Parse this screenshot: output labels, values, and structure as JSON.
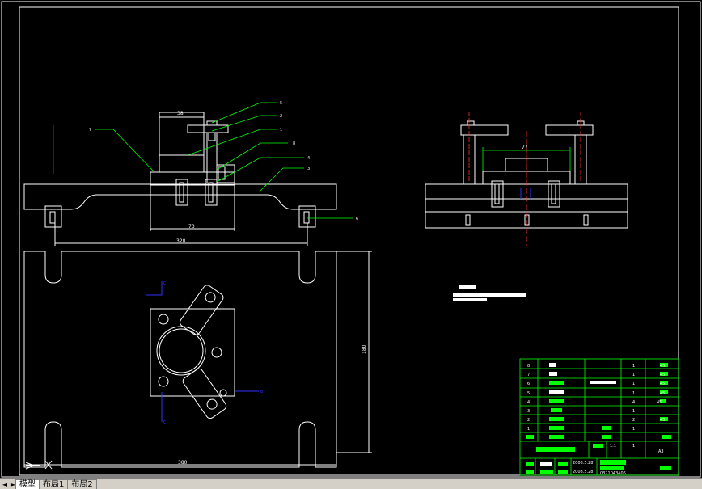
{
  "tabs": [
    {
      "label": "模型",
      "active": true
    },
    {
      "label": "布局1",
      "active": false
    },
    {
      "label": "布局2",
      "active": false
    }
  ],
  "tab_nav": {
    "first": "◄",
    "prev": "►"
  },
  "front_view": {
    "dim_top": "38",
    "dim_mid": "73",
    "dim_bottom": "320",
    "leaders": [
      "5",
      "2",
      "1",
      "8",
      "4",
      "3",
      "6",
      "7"
    ]
  },
  "side_view": {
    "dim_top": "77"
  },
  "plan_view": {
    "dim_right": "180",
    "dim_bottom": "380",
    "section_marks": [
      "C",
      "C",
      "B"
    ]
  },
  "title_block": {
    "row_numbers": [
      "8",
      "7",
      "6",
      "5",
      "4",
      "3",
      "2",
      "1"
    ],
    "qty": [
      "1",
      "1",
      "1",
      "1",
      "4",
      "1",
      "2",
      "1"
    ],
    "material": [
      "45",
      "45",
      "45",
      "45",
      "45",
      "",
      "45",
      ""
    ],
    "scale": "1:1",
    "sheet_count": "1",
    "size": "A3",
    "date1": "2008.5.28",
    "date2": "2008.5.28",
    "student_id": "0321043406"
  },
  "colors": {
    "background": "#000000",
    "line": "#ffffff",
    "leader": "#00ff00",
    "centerline": "#ff0000",
    "axis": "#0000ff"
  }
}
